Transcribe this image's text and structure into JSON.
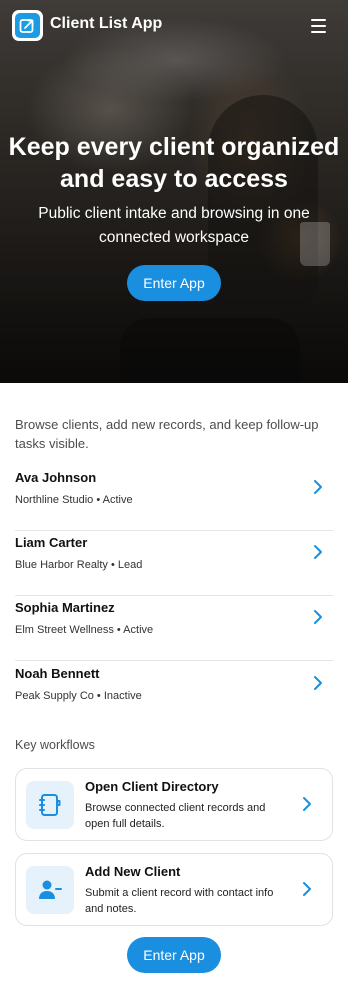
{
  "header": {
    "app_title": "Client List App",
    "logo_icon": "upload-box-icon",
    "menu_icon": "hamburger-menu-icon"
  },
  "hero": {
    "title": "Keep every client organized and easy to access",
    "subtitle": "Public client intake and browsing in one connected workspace",
    "cta_label": "Enter App"
  },
  "intro": {
    "text": "Browse clients, add new records, and keep follow-up tasks visible."
  },
  "clients": [
    {
      "name": "Ava Johnson",
      "meta": "Northline Studio • Active"
    },
    {
      "name": "Liam Carter",
      "meta": "Blue Harbor Realty • Lead"
    },
    {
      "name": "Sophia Martinez",
      "meta": "Elm Street Wellness • Active"
    },
    {
      "name": "Noah Bennett",
      "meta": "Peak Supply Co • Inactive"
    }
  ],
  "workflows": {
    "label": "Key workflows",
    "items": [
      {
        "title": "Open Client Directory",
        "desc": "Browse connected client records and open full details.",
        "icon": "address-book-icon"
      },
      {
        "title": "Add New Client",
        "desc": "Submit a client record with contact info and notes.",
        "icon": "user-minus-icon"
      }
    ]
  },
  "footer": {
    "cta_label": "Enter App"
  },
  "colors": {
    "accent": "#1a8fe0",
    "icon_bg": "#e6f2fb"
  }
}
